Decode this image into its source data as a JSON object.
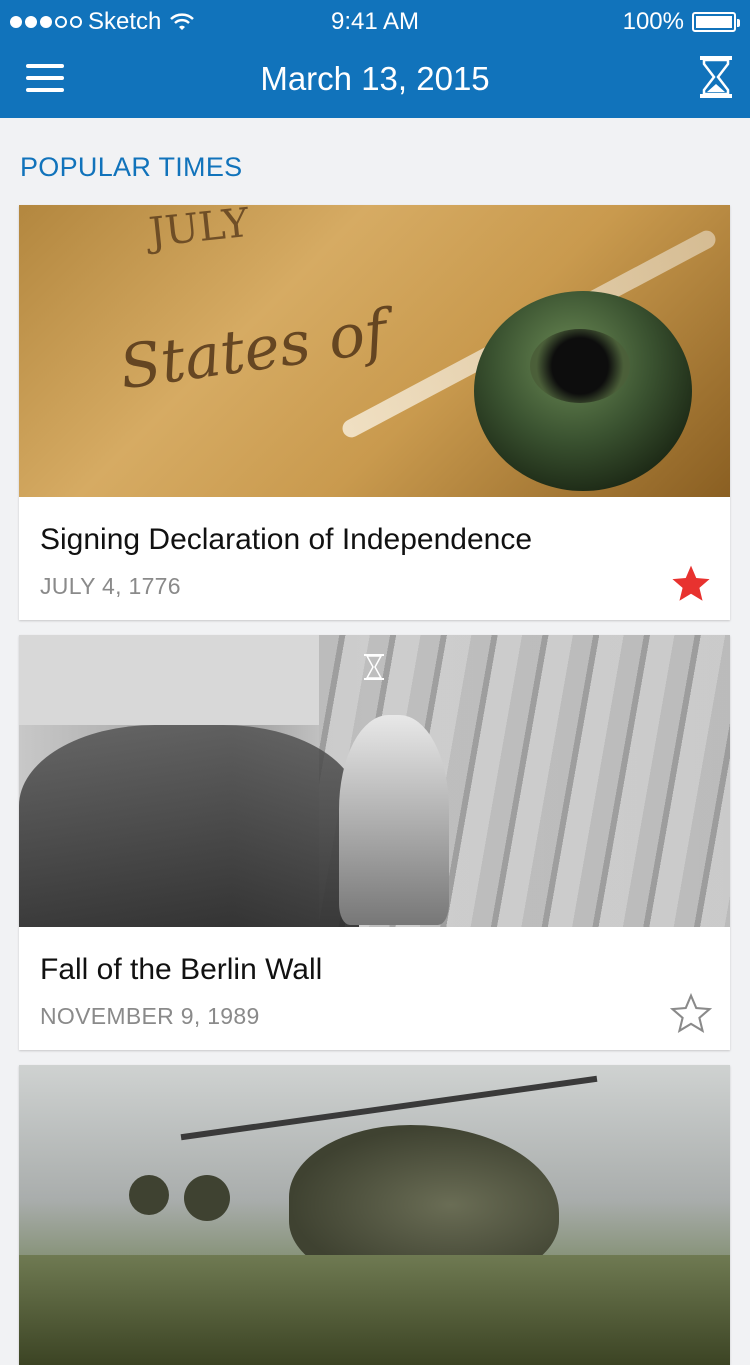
{
  "status_bar": {
    "carrier": "Sketch",
    "time": "9:41 AM",
    "battery": "100%"
  },
  "nav": {
    "title": "March 13, 2015",
    "menu_icon": "hamburger-menu-icon",
    "right_icon": "hourglass-icon"
  },
  "section": {
    "title": "POPULAR TIMES"
  },
  "cards": [
    {
      "title": "Signing Declaration of Independence",
      "date": "JULY 4, 1776",
      "favorited": true
    },
    {
      "title": "Fall of the Berlin Wall",
      "date": "NOVEMBER 9, 1989",
      "favorited": false
    },
    {
      "title": "",
      "date": ""
    }
  ],
  "colors": {
    "brand": "#1173bb",
    "star_active": "#e8322f",
    "star_inactive": "#8a8a8a",
    "background": "#f1f2f4"
  }
}
